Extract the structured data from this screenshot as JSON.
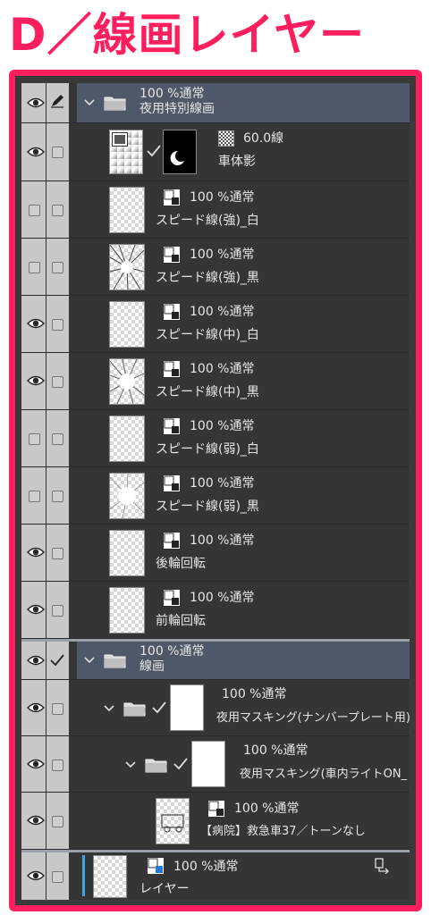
{
  "title": "D／線画レイヤー",
  "colors": {
    "accent": "#ff1f5f",
    "folder_header": "#4f5868",
    "panel": "#353535",
    "selected_bar": "#3da6e8"
  },
  "layers": [
    {
      "id": "folder-yakan",
      "kind": "folder",
      "opacity": "100 %通常",
      "name": "夜用特別線画",
      "visible": true,
      "icon": "folder-icon"
    },
    {
      "id": "shadow",
      "kind": "tone",
      "opacity": "60.0線",
      "name": "車体影",
      "visible": true
    },
    {
      "id": "speed-strong-white",
      "kind": "raster",
      "opacity": "100 %通常",
      "name": "スピード線(強)_白",
      "visible": false
    },
    {
      "id": "speed-strong-black",
      "kind": "raster",
      "opacity": "100 %通常",
      "name": "スピード線(強)_黒",
      "visible": false
    },
    {
      "id": "speed-mid-white",
      "kind": "raster",
      "opacity": "100 %通常",
      "name": "スピード線(中)_白",
      "visible": true
    },
    {
      "id": "speed-mid-black",
      "kind": "raster",
      "opacity": "100 %通常",
      "name": "スピード線(中)_黒",
      "visible": true
    },
    {
      "id": "speed-weak-white",
      "kind": "raster",
      "opacity": "100 %通常",
      "name": "スピード線(弱)_白",
      "visible": false
    },
    {
      "id": "speed-weak-black",
      "kind": "raster",
      "opacity": "100 %通常",
      "name": "スピード線(弱)_黒",
      "visible": false
    },
    {
      "id": "rear-wheel",
      "kind": "raster",
      "opacity": "100 %通常",
      "name": "後輪回転",
      "visible": true
    },
    {
      "id": "front-wheel",
      "kind": "raster",
      "opacity": "100 %通常",
      "name": "前輪回転",
      "visible": true
    },
    {
      "id": "folder-senga",
      "kind": "folder",
      "opacity": "100 %通常",
      "name": "線画",
      "visible": true
    },
    {
      "id": "mask-plate",
      "kind": "folder",
      "opacity": "100 %通常",
      "name": "夜用マスキング(ナンバープレート用)",
      "visible": true
    },
    {
      "id": "mask-light",
      "kind": "folder",
      "opacity": "100 %通常",
      "name": "夜用マスキング(車内ライトON_",
      "visible": true
    },
    {
      "id": "ambulance",
      "kind": "raster",
      "opacity": "100 %通常",
      "name": "【病院】救急車37／トーンなし",
      "visible": true
    },
    {
      "id": "layer",
      "kind": "raster",
      "opacity": "100 %通常",
      "name": "レイヤー",
      "visible": true
    }
  ]
}
